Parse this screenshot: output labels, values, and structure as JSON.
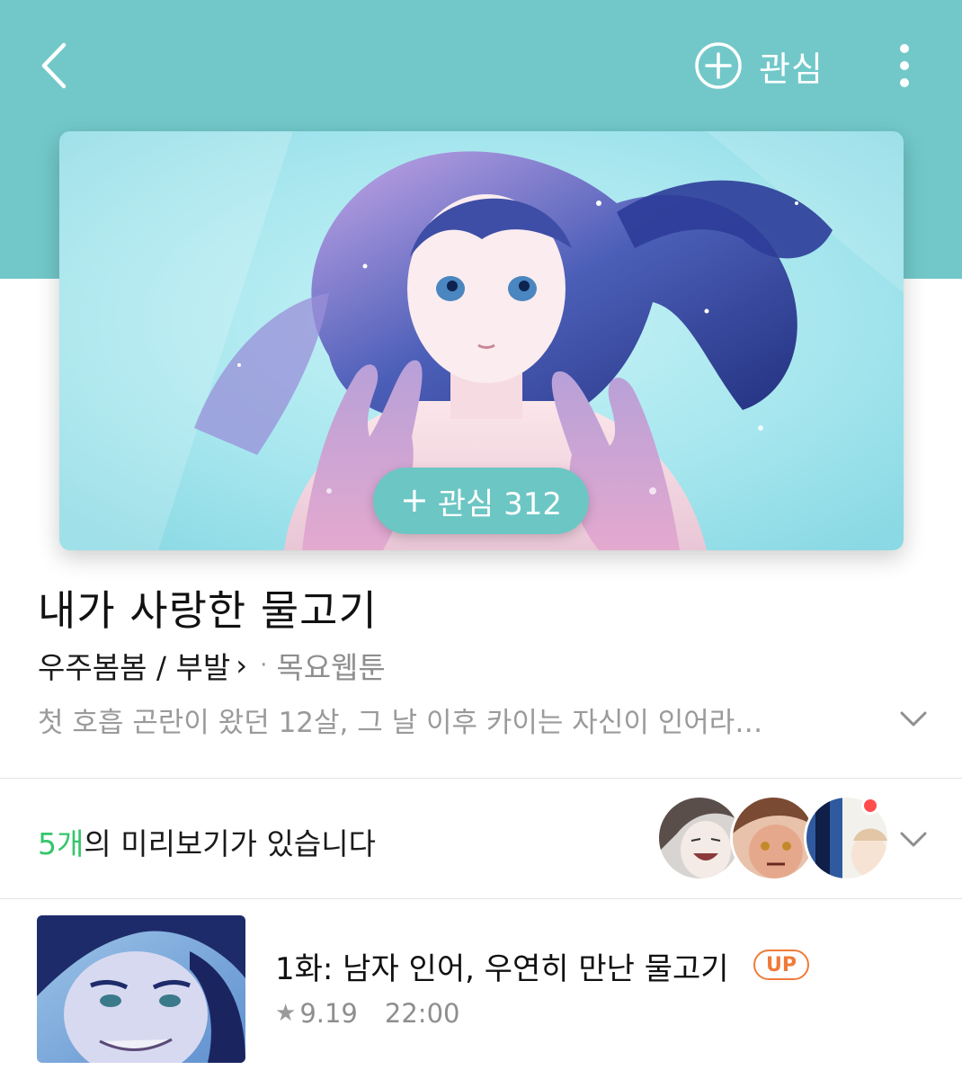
{
  "header": {
    "back_icon": "chevron-left-icon",
    "follow_label": "관심",
    "follow_icon": "circle-plus-icon",
    "more_icon": "more-vertical-icon",
    "band_color": "#72c8c9"
  },
  "cover": {
    "follow_plus": "+",
    "follow_label": "관심 312"
  },
  "title": "내가 사랑한 물고기",
  "meta": {
    "authors": "우주봄봄 / 부발",
    "author_chevron": "›",
    "separator": "·",
    "weekday": "목요웹툰"
  },
  "synopsis": "첫 호흡 곤란이 왔던 12살, 그 날 이후 카이는 자신이 인어라…",
  "previews": {
    "count": "5개",
    "text": "의 미리보기가 있습니다",
    "accent_color": "#35c66b"
  },
  "episodes": [
    {
      "title": "1화: 남자 인어, 우연히 만난 물고기",
      "badge": "UP",
      "rating_icon": "star-icon",
      "star": "★",
      "rating": "9.19",
      "time": "22:00"
    }
  ]
}
